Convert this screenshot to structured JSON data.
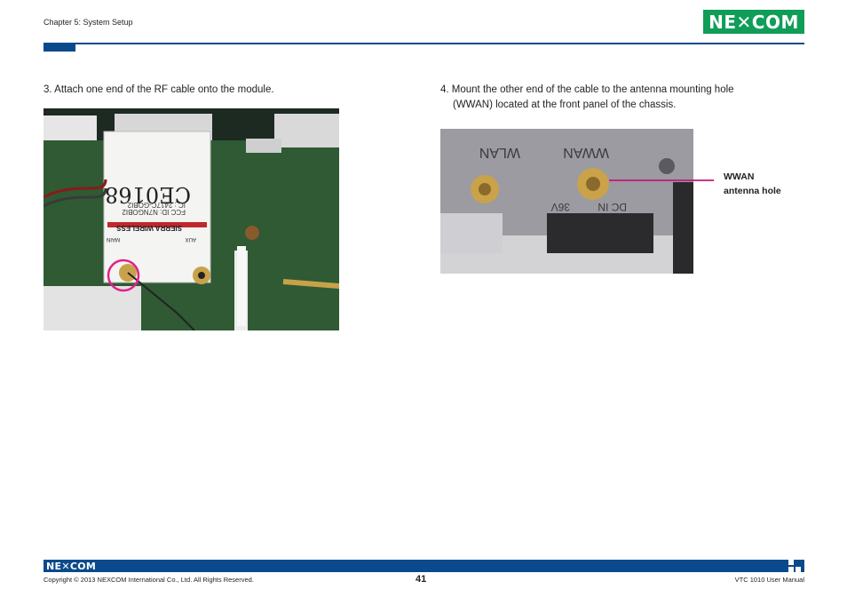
{
  "header": {
    "chapter": "Chapter 5: System Setup",
    "logo_text": "NE✕COM"
  },
  "steps": {
    "left": "3. Attach one end of the RF cable onto the module.",
    "right_line1": "4. Mount the other end of the cable to the antenna mounting hole",
    "right_line2": "(WWAN) located at the front panel of the chassis."
  },
  "photo_left": {
    "fcc_id": "FCC ID: N7NGOBI2",
    "ic": "IC : 2417C-GOBI2",
    "ce_mark": "CE0168",
    "brand": "SIERRA WIRELESS",
    "main_label": "MAIN",
    "aux_label": "AUX"
  },
  "photo_right": {
    "wlan_label": "WLAN",
    "wwan_label": "WWAN",
    "dc_in_label": "DC IN",
    "voltage_label": "36V"
  },
  "callout": {
    "line1": "WWAN",
    "line2": "antenna hole"
  },
  "footer": {
    "logo_text": "NE✕COM",
    "copyright": "Copyright © 2013 NEXCOM International Co., Ltd. All Rights Reserved.",
    "page_number": "41",
    "manual_title": "VTC 1010 User Manual"
  },
  "colors": {
    "brand_blue": "#0a4a8c",
    "logo_green": "#0f9d58",
    "callout_magenta": "#c2187a"
  }
}
